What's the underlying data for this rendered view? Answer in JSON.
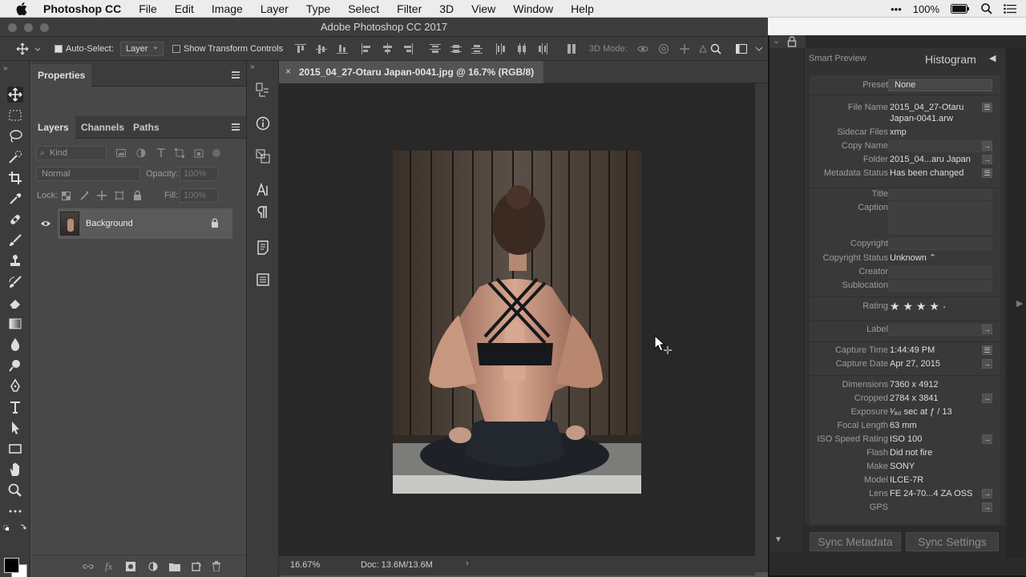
{
  "menubar": {
    "app_name": "Photoshop CC",
    "items": [
      "File",
      "Edit",
      "Image",
      "Layer",
      "Type",
      "Select",
      "Filter",
      "3D",
      "View",
      "Window",
      "Help"
    ],
    "battery": "100%",
    "more": "•••"
  },
  "window": {
    "title": "Adobe Photoshop CC 2017"
  },
  "options": {
    "auto_select_label": "Auto-Select:",
    "auto_select_value": "Layer",
    "transform_label": "Show Transform Controls",
    "mode_3d": "3D Mode:"
  },
  "layers_panel": {
    "properties_tab": "Properties",
    "tabs": [
      "Layers",
      "Channels",
      "Paths"
    ],
    "kind_placeholder": "Kind",
    "blend_mode": "Normal",
    "opacity_label": "Opacity:",
    "opacity_value": "100%",
    "lock_label": "Lock:",
    "fill_label": "Fill:",
    "fill_value": "100%",
    "layer_name": "Background"
  },
  "document": {
    "tab_title": "2015_04_27-Otaru Japan-0041.jpg @ 16.7% (RGB/8)",
    "zoom": "16.67%",
    "doc_size": "Doc: 13.6M/13.6M"
  },
  "lightroom": {
    "smart_preview": "Smart Preview",
    "panel_title": "Histogram",
    "preset_label": "Preset",
    "preset_value": "None",
    "rows": [
      {
        "label": "File Name",
        "value": "2015_04_27-Otaru"
      },
      {
        "label": "",
        "value": "Japan-0041.arw"
      },
      {
        "label": "Sidecar Files",
        "value": "xmp"
      },
      {
        "label": "Copy Name",
        "value": ""
      },
      {
        "label": "Folder",
        "value": "2015_04...aru Japan"
      },
      {
        "label": "Metadata Status",
        "value": "Has been changed"
      },
      {
        "label": "Title",
        "value": ""
      },
      {
        "label": "Caption",
        "value": ""
      },
      {
        "label": "Copyright",
        "value": ""
      },
      {
        "label": "Copyright Status",
        "value": "Unknown ⌃"
      },
      {
        "label": "Creator",
        "value": ""
      },
      {
        "label": "Sublocation",
        "value": ""
      },
      {
        "label": "Rating",
        "value": "★ ★ ★ ★ ·"
      },
      {
        "label": "Label",
        "value": ""
      },
      {
        "label": "Capture Time",
        "value": "1:44:49 PM"
      },
      {
        "label": "Capture Date",
        "value": "Apr 27, 2015"
      },
      {
        "label": "Dimensions",
        "value": "7360 x 4912"
      },
      {
        "label": "Cropped",
        "value": "2784 x 3841"
      },
      {
        "label": "Exposure",
        "value": "¹⁄₈₀ sec at ƒ / 13"
      },
      {
        "label": "Focal Length",
        "value": "63 mm"
      },
      {
        "label": "ISO Speed Rating",
        "value": "ISO 100"
      },
      {
        "label": "Flash",
        "value": "Did not fire"
      },
      {
        "label": "Make",
        "value": "SONY"
      },
      {
        "label": "Model",
        "value": "ILCE-7R"
      },
      {
        "label": "Lens",
        "value": "FE 24-70...4 ZA OSS"
      },
      {
        "label": "GPS",
        "value": ""
      }
    ],
    "rating_stars": 4,
    "sync_metadata": "Sync Metadata",
    "sync_settings": "Sync Settings"
  }
}
